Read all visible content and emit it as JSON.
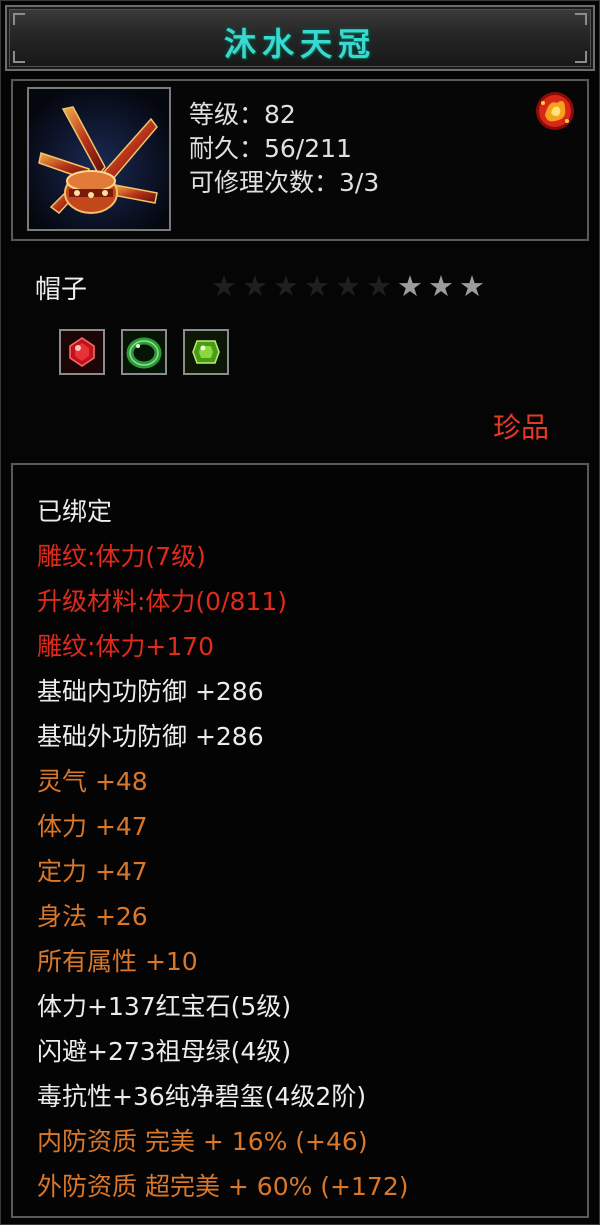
{
  "item": {
    "name": "沐水天冠",
    "level": "等级：82",
    "durability": "耐久：56/211",
    "repairs": "可修理次数：3/3",
    "type": "帽子",
    "rarity": "珍品",
    "rarity_color": "#e43a25",
    "stars": {
      "total": 9,
      "lit": 3
    },
    "gems": [
      {
        "icon": "red-ruby-gem-icon",
        "color": "#c0141c"
      },
      {
        "icon": "green-jade-ring-icon",
        "color": "#2e9a3a"
      },
      {
        "icon": "green-emerald-gem-icon",
        "color": "#6cc92a"
      }
    ]
  },
  "attributes": [
    {
      "text": "已绑定",
      "color": "white"
    },
    {
      "text": "雕纹:体力(7级)",
      "color": "red"
    },
    {
      "text": "升级材料:体力(0/811)",
      "color": "red"
    },
    {
      "text": "雕纹:体力+170",
      "color": "red"
    },
    {
      "text": "基础内功防御  +286",
      "color": "white"
    },
    {
      "text": "基础外功防御  +286",
      "color": "white"
    },
    {
      "text": "灵气  +48",
      "color": "orange"
    },
    {
      "text": "体力  +47",
      "color": "orange"
    },
    {
      "text": "定力  +47",
      "color": "orange"
    },
    {
      "text": "身法  +26",
      "color": "orange"
    },
    {
      "text": "所有属性  +10",
      "color": "orange"
    },
    {
      "text": "体力+137红宝石(5级)",
      "color": "white"
    },
    {
      "text": "闪避+273祖母绿(4级)",
      "color": "white"
    },
    {
      "text": "毒抗性+36纯净碧玺(4级2阶)",
      "color": "white"
    },
    {
      "text": "内防资质  完美  +  16%  (+46)",
      "color": "orange"
    },
    {
      "text": "外防资质  超完美  +  60%  (+172)",
      "color": "orange"
    }
  ],
  "colors": {
    "title": "#39d8d0",
    "red": "#e02a1c",
    "orange": "#d9772a",
    "white": "#ececec"
  }
}
